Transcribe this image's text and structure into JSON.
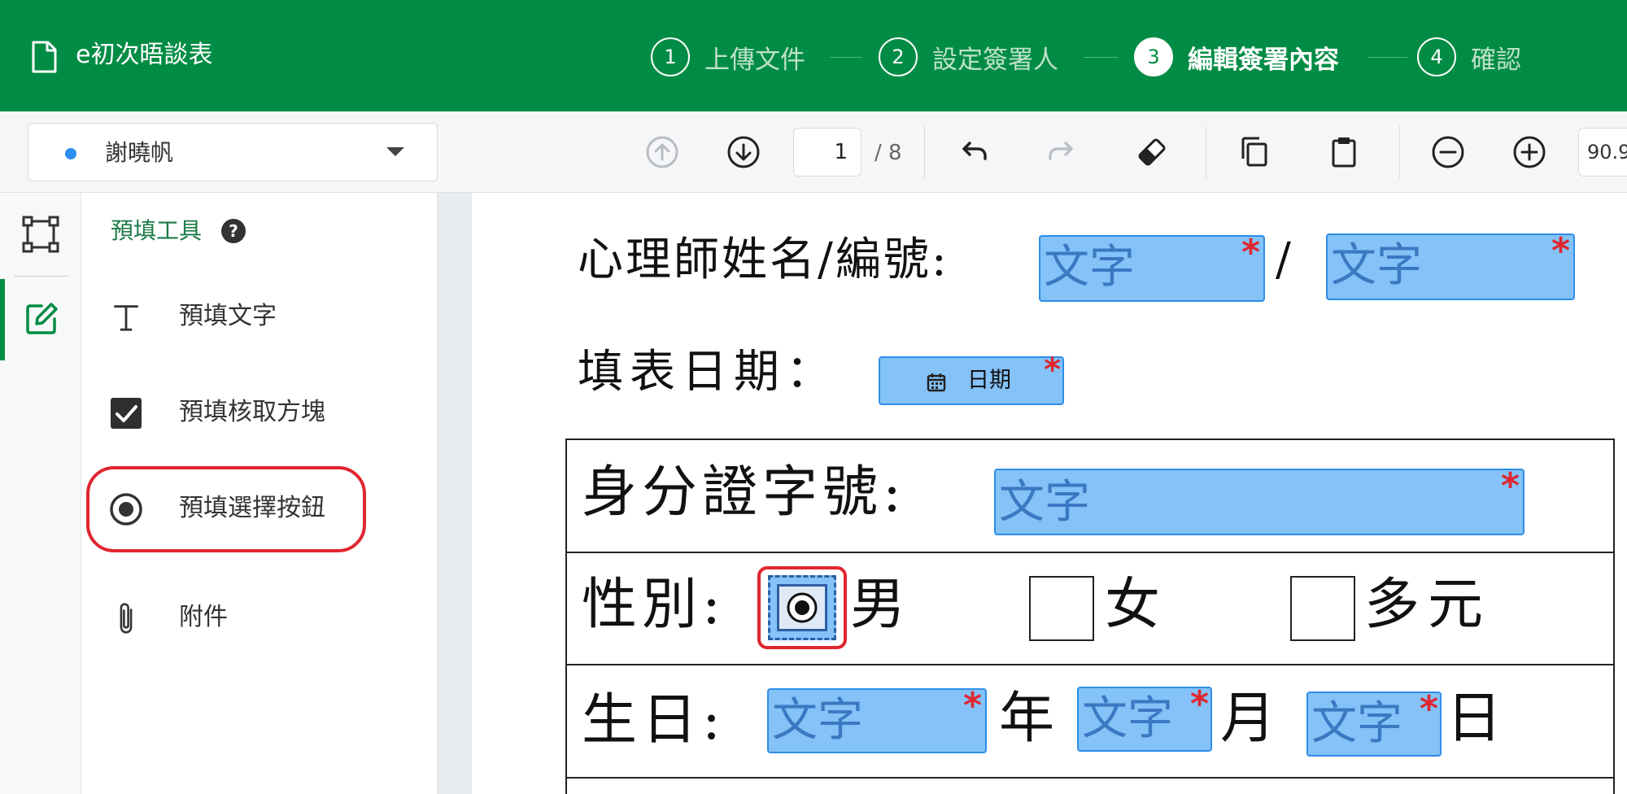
{
  "header": {
    "doc_title": "e初次晤談表",
    "steps": [
      {
        "num": "1",
        "label": "上傳文件"
      },
      {
        "num": "2",
        "label": "設定簽署人"
      },
      {
        "num": "3",
        "label": "編輯簽署內容"
      },
      {
        "num": "4",
        "label": "確認"
      }
    ],
    "active_step": 3
  },
  "toolbar": {
    "signer_name": "謝曉帆",
    "signer_color": "#2b8ef0",
    "page_current": "1",
    "page_total": "/ 8",
    "zoom": "90.9"
  },
  "panel": {
    "title": "預填工具",
    "tools": [
      {
        "label": "預填文字",
        "icon": "text-icon"
      },
      {
        "label": "預填核取方塊",
        "icon": "checkbox-icon"
      },
      {
        "label": "預填選擇按鈕",
        "icon": "radio-icon",
        "highlighted": true
      },
      {
        "label": "附件",
        "icon": "paperclip-icon"
      }
    ]
  },
  "document": {
    "psychologist_label": "心理師姓名/編號:",
    "slash": "/",
    "date_label": "填表日期：",
    "date_field": "日期",
    "id_label": "身分證字號:",
    "gender_label": "性別:",
    "gender_male": "男",
    "gender_female": "女",
    "gender_other": "多元",
    "birthday_label": "生日:",
    "year": "年",
    "month": "月",
    "day": "日",
    "text_placeholder": "文字",
    "required_mark": "*"
  },
  "colors": {
    "brand_green": "#008c44",
    "field_fill": "#84c2f7",
    "field_border": "#2e8ee8",
    "required_red": "#e0262f"
  }
}
